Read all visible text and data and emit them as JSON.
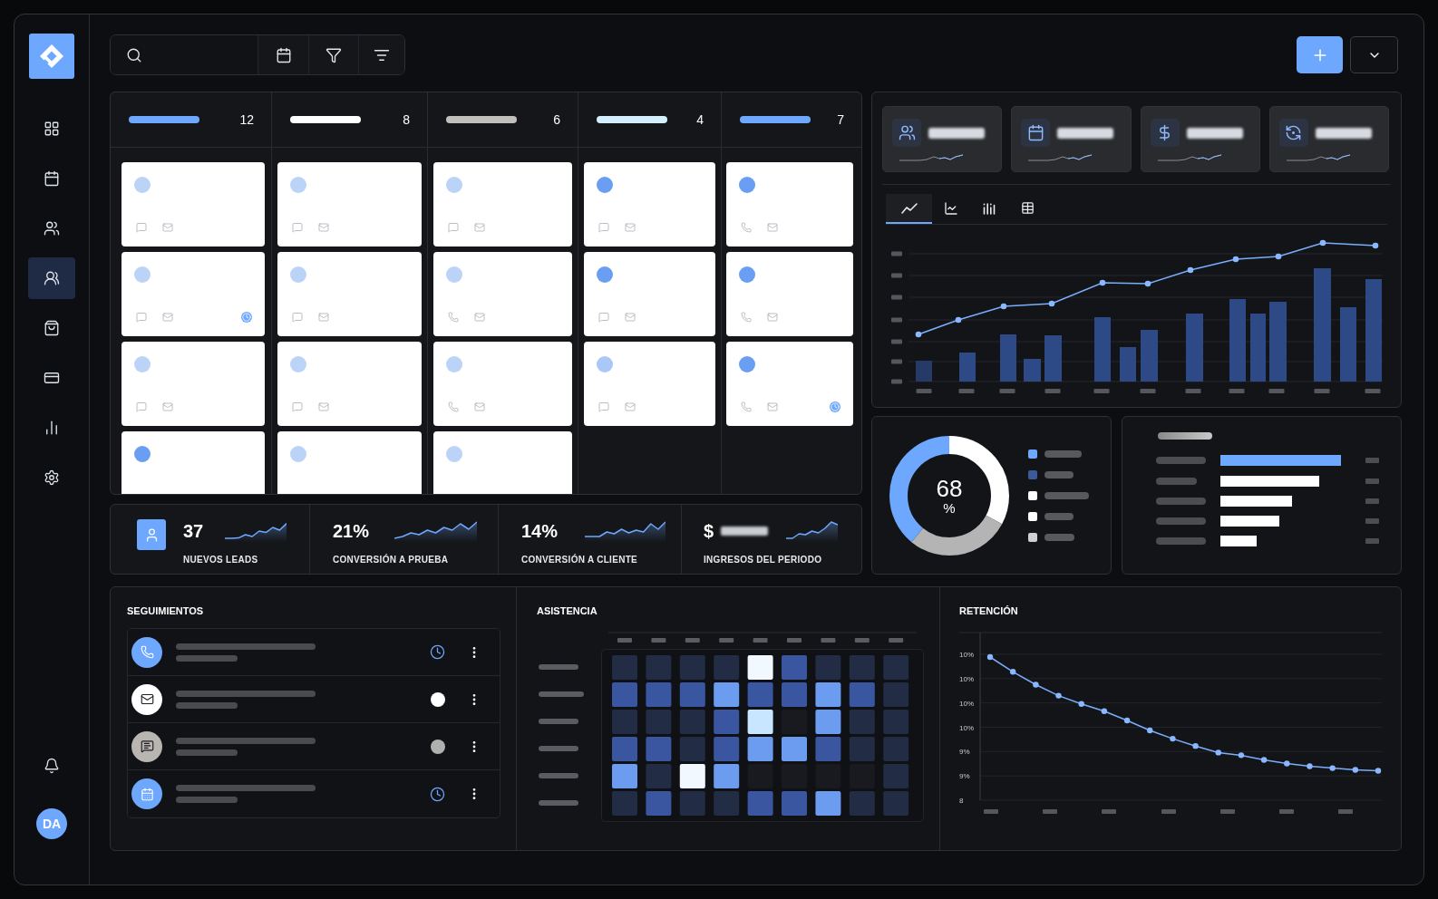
{
  "nav": [
    {
      "selected": false
    },
    {
      "selected": false
    },
    {
      "selected": false
    },
    {
      "selected": true
    },
    {
      "selected": false
    },
    {
      "selected": false
    },
    {
      "selected": false
    },
    {
      "selected": false
    }
  ],
  "user": {
    "initials": "DA"
  },
  "kanban": [
    {
      "color": "#6ea8fe",
      "count": "12",
      "cards": [
        {
          "kind": "chat",
          "color": "#bcd3f8",
          "reminder": false
        },
        {
          "kind": "chat",
          "color": "#bcd3f8",
          "reminder": true
        },
        {
          "kind": "chat",
          "color": "#bcd3f8",
          "reminder": false
        },
        {
          "kind": "partial",
          "color": "#6a9ef2"
        }
      ]
    },
    {
      "color": "#ffffff",
      "count": "8",
      "cards": [
        {
          "kind": "chat",
          "color": "#bcd3f8",
          "reminder": false
        },
        {
          "kind": "chat",
          "color": "#bcd3f8",
          "reminder": false
        },
        {
          "kind": "chat",
          "color": "#bcd3f8",
          "reminder": false
        },
        {
          "kind": "partial",
          "color": "#bcd3f8"
        }
      ]
    },
    {
      "color": "#c2c0bd",
      "count": "6",
      "cards": [
        {
          "kind": "chat",
          "color": "#bcd3f8",
          "reminder": false
        },
        {
          "kind": "phone",
          "color": "#bcd3f8",
          "reminder": false
        },
        {
          "kind": "phone",
          "color": "#bcd3f8",
          "reminder": false
        },
        {
          "kind": "partial",
          "color": "#bcd3f8"
        }
      ]
    },
    {
      "color": "#d4f0ff",
      "count": "4",
      "cards": [
        {
          "kind": "chat",
          "color": "#6a9ef2",
          "reminder": false
        },
        {
          "kind": "chat",
          "color": "#6a9ef2",
          "reminder": false
        },
        {
          "kind": "chat",
          "color": "#a9c8f7",
          "reminder": false
        }
      ]
    },
    {
      "color": "#6ea8fe",
      "count": "7",
      "cards": [
        {
          "kind": "phone",
          "color": "#6a9ef2",
          "reminder": false
        },
        {
          "kind": "phone",
          "color": "#6a9ef2",
          "reminder": false
        },
        {
          "kind": "phone",
          "color": "#6a9ef2",
          "reminder": true
        }
      ]
    }
  ],
  "chart_tabs": [
    {
      "selected": true
    },
    {
      "selected": false
    },
    {
      "selected": false
    },
    {
      "selected": false
    }
  ],
  "kpis": [
    {
      "kind": "leads",
      "value": "37",
      "label": "NUEVOS LEADS"
    },
    {
      "kind": "rate",
      "value": "21%",
      "label": "CONVERSIÓN A PRUEBA"
    },
    {
      "kind": "rate",
      "value": "14%",
      "label": "CONVERSIÓN A CLIENTE"
    },
    {
      "kind": "revenue",
      "value": "$",
      "label": "INGRESOS DEL PERIODO"
    }
  ],
  "donut": {
    "value": "68",
    "unit": "%",
    "legend": [
      {
        "color": "#6ea8fe"
      },
      {
        "color": "#3a5a9a"
      },
      {
        "color": "#ffffff"
      },
      {
        "color": "#ffffff"
      },
      {
        "color": "#d0d0d0"
      }
    ]
  },
  "followups": {
    "title": "SEGUIMIENTOS",
    "rows": [
      {
        "color": "#6ea8fe",
        "status": {
          "kind": "clock"
        }
      },
      {
        "color": "#ffffff",
        "status": {
          "kind": "dot",
          "color": "#ffffff"
        }
      },
      {
        "color": "#b9b6b1",
        "status": {
          "kind": "dot",
          "color": "#b0b0b0"
        }
      },
      {
        "color": "#6ea8fe",
        "status": {
          "kind": "clock"
        }
      }
    ]
  },
  "attendance": {
    "title": "ASISTENCIA"
  },
  "retention": {
    "title": "RETENCIÓN",
    "y_axis_labels": [
      "10%",
      "10%",
      "10%",
      "10%",
      "9%",
      "9%",
      "8"
    ]
  }
}
